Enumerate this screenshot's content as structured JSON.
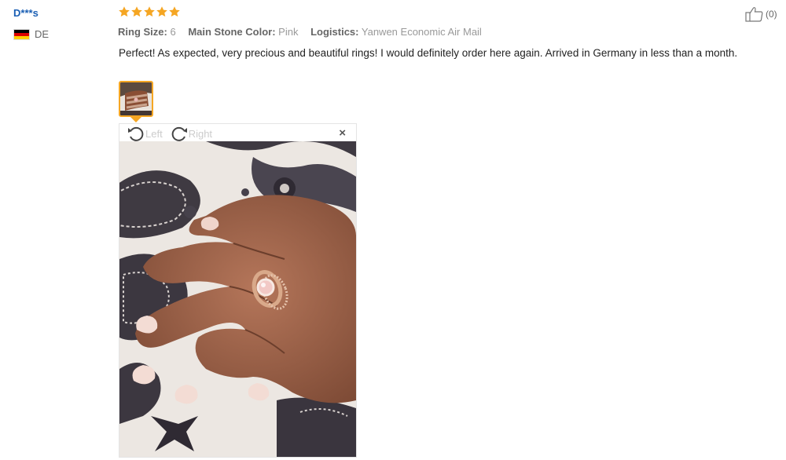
{
  "reviewer": {
    "name": "D***s",
    "country": "DE"
  },
  "rating": {
    "stars": 5,
    "max": 5,
    "star_color": "#f5a623"
  },
  "attributes": [
    {
      "key": "Ring Size:",
      "value": "6"
    },
    {
      "key": "Main Stone Color:",
      "value": "Pink"
    },
    {
      "key": "Logistics:",
      "value": "Yanwen Economic Air Mail"
    }
  ],
  "review": {
    "text": "Perfect! As expected, very precious and beautiful rings! I would definitely order here again. Arrived in Germany in less than a month."
  },
  "helpful": {
    "count_label": "(0)",
    "icon": "thumbs-up-icon"
  },
  "viewer": {
    "rotate_left_label": "Left",
    "rotate_right_label": "Right",
    "close_glyph": "×"
  },
  "colors": {
    "accent": "#f5a623",
    "name_link": "#1a5fb4"
  }
}
